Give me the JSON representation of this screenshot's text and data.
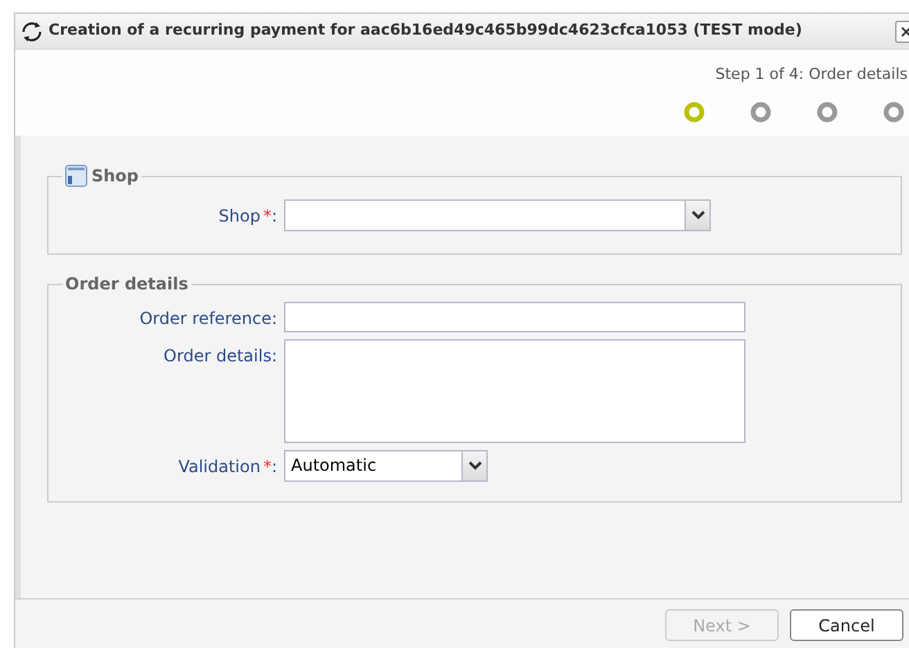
{
  "window": {
    "title": "Creation of a recurring payment for aac6b16ed49c465b99dc4623cfca1053 (TEST mode)"
  },
  "steps": {
    "caption": "Step 1 of 4: Order details",
    "items": [
      {
        "selected": true
      },
      {
        "selected": false
      },
      {
        "selected": false
      },
      {
        "selected": false
      }
    ]
  },
  "sections": [
    {
      "legend": "Shop",
      "has_icon": true,
      "fields": [
        {
          "kind": "select",
          "label": "Shop",
          "required": true,
          "colon": ":"
        }
      ]
    },
    {
      "legend": "Order details",
      "has_icon": false,
      "fields": [
        {
          "kind": "text",
          "label": "Order reference",
          "required": false,
          "colon": ":"
        },
        {
          "kind": "textarea",
          "label": "Order details",
          "required": false,
          "colon": ":"
        },
        {
          "kind": "select",
          "label": "Validation",
          "required": true,
          "colon": ":",
          "value": "Automatic"
        }
      ]
    }
  ],
  "required_mark": "*",
  "buttons": [
    {
      "label": "Next >",
      "disabled": true
    },
    {
      "label": "Cancel",
      "disabled": false
    }
  ]
}
